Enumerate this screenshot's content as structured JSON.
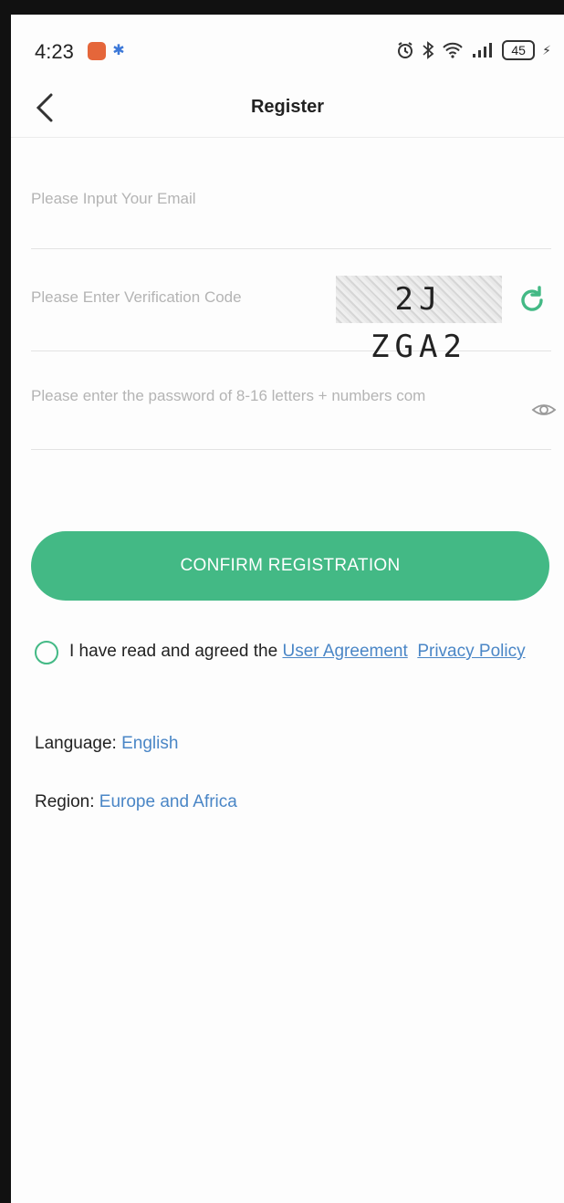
{
  "status_bar": {
    "time": "4:23",
    "battery": "45",
    "icons": [
      "app-notification-icon",
      "bluetooth-icon",
      "alarm-icon",
      "bluetooth-icon",
      "wifi-icon",
      "signal-icon",
      "battery-icon",
      "charging-icon"
    ]
  },
  "header": {
    "title": "Register",
    "back_icon": "chevron-left-icon"
  },
  "form": {
    "email_placeholder": "Please Input Your Email",
    "code_placeholder": "Please Enter Verification Code",
    "captcha_text": "2J ZGA2",
    "refresh_icon": "refresh-icon",
    "password_placeholder": "Please enter the password of 8-16 letters + numbers com",
    "eye_icon": "eye-icon"
  },
  "confirm_button": "CONFIRM REGISTRATION",
  "agreement": {
    "text": "I have read and agreed the ",
    "user_agreement": "User Agreement",
    "privacy_policy": "Privacy Policy"
  },
  "language": {
    "label": "Language: ",
    "value": "English"
  },
  "region": {
    "label": "Region: ",
    "value": "Europe and Africa"
  },
  "colors": {
    "accent": "#43b985",
    "link": "#4a86c6"
  }
}
